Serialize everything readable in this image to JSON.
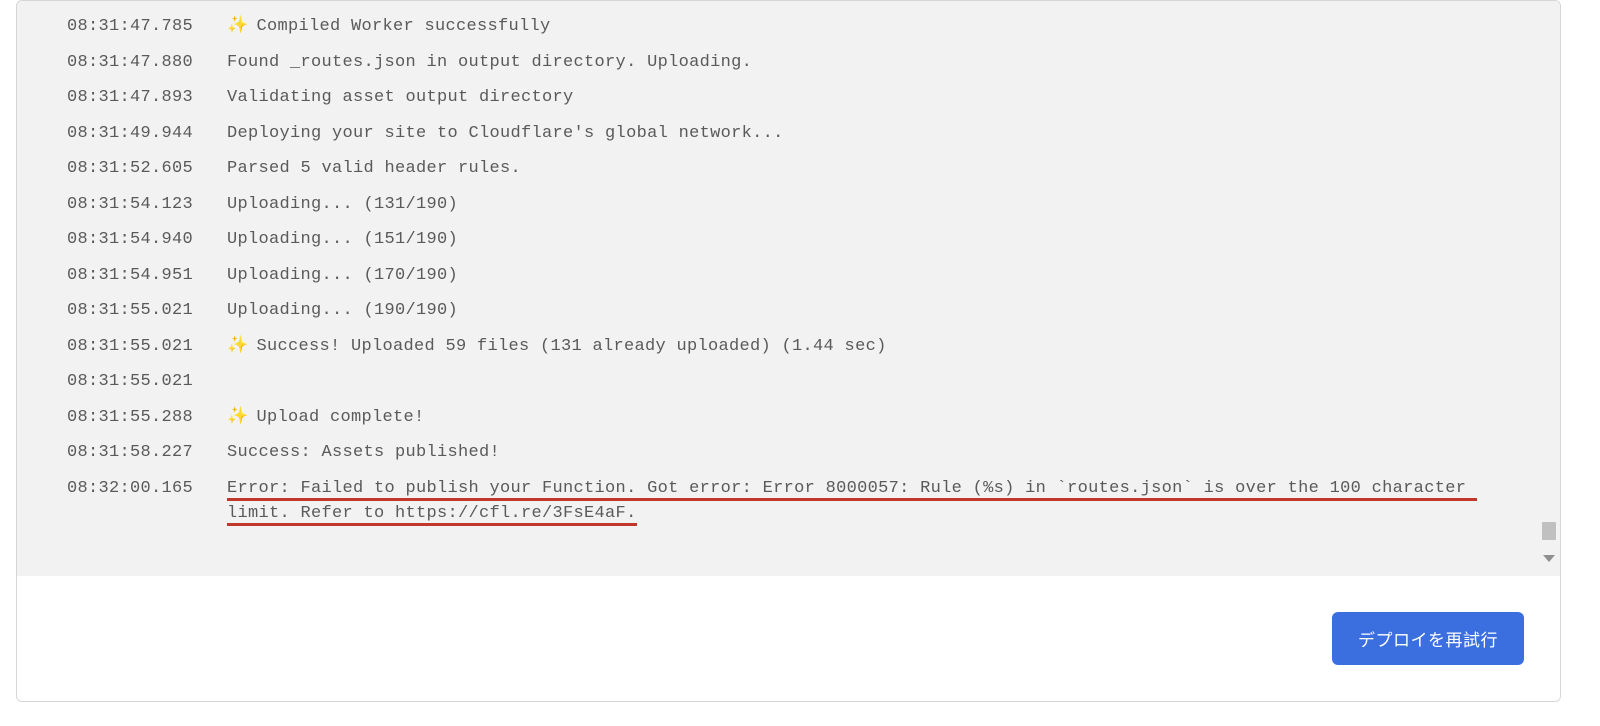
{
  "logs": [
    {
      "ts": "08:31:47.785",
      "sparkle": true,
      "msg": "Compiled Worker successfully"
    },
    {
      "ts": "08:31:47.880",
      "sparkle": false,
      "msg": "Found _routes.json in output directory. Uploading."
    },
    {
      "ts": "08:31:47.893",
      "sparkle": false,
      "msg": "Validating asset output directory"
    },
    {
      "ts": "08:31:49.944",
      "sparkle": false,
      "msg": "Deploying your site to Cloudflare's global network..."
    },
    {
      "ts": "08:31:52.605",
      "sparkle": false,
      "msg": "Parsed 5 valid header rules."
    },
    {
      "ts": "08:31:54.123",
      "sparkle": false,
      "msg": "Uploading... (131/190)"
    },
    {
      "ts": "08:31:54.940",
      "sparkle": false,
      "msg": "Uploading... (151/190)"
    },
    {
      "ts": "08:31:54.951",
      "sparkle": false,
      "msg": "Uploading... (170/190)"
    },
    {
      "ts": "08:31:55.021",
      "sparkle": false,
      "msg": "Uploading... (190/190)"
    },
    {
      "ts": "08:31:55.021",
      "sparkle": true,
      "msg": "Success! Uploaded 59 files (131 already uploaded) (1.44 sec)"
    },
    {
      "ts": "08:31:55.021",
      "sparkle": false,
      "msg": ""
    },
    {
      "ts": "08:31:55.288",
      "sparkle": true,
      "msg": "Upload complete!"
    },
    {
      "ts": "08:31:58.227",
      "sparkle": false,
      "msg": "Success: Assets published!"
    },
    {
      "ts": "08:32:00.165",
      "sparkle": false,
      "error": true,
      "msg": "Error: Failed to publish your Function. Got error: Error 8000057: Rule (%s) in `routes.json` is over the 100 character limit. Refer to https://cfl.re/3FsE4aF."
    }
  ],
  "sparkle_glyph": "✨",
  "footer": {
    "retry_label": "デプロイを再試行"
  }
}
